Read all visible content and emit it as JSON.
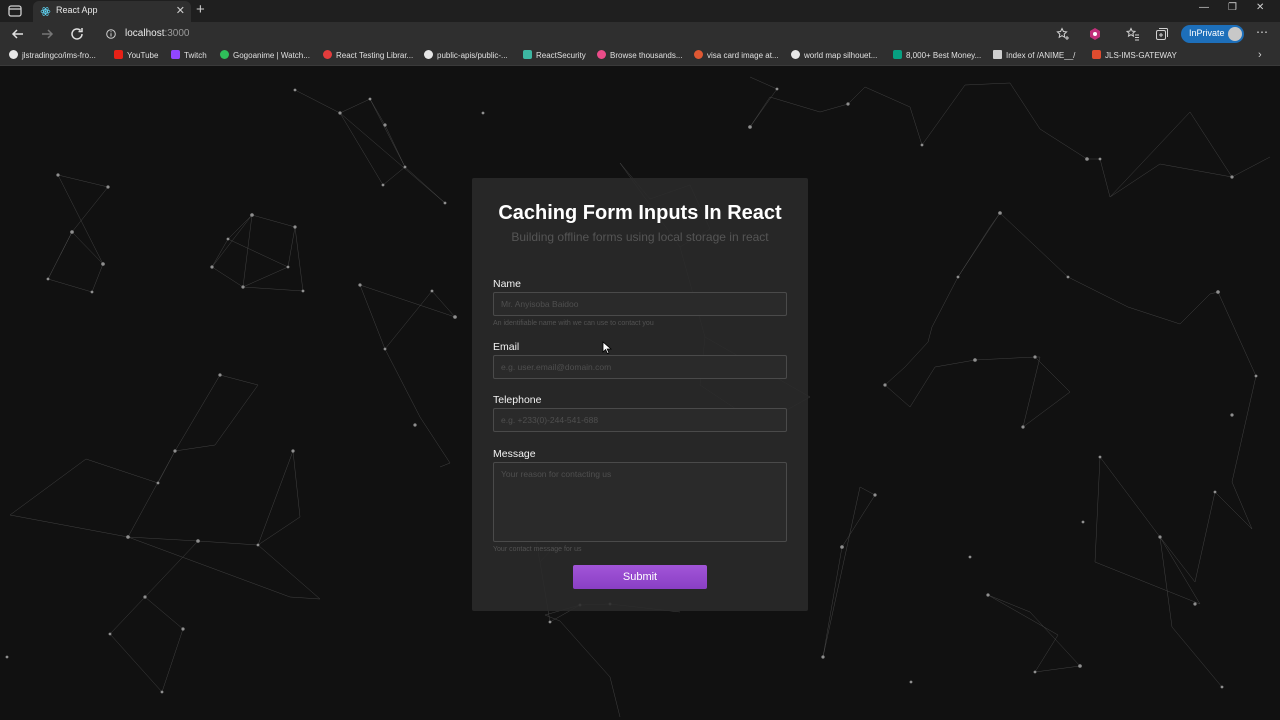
{
  "browser": {
    "tab_title": "React App",
    "url_host": "localhost",
    "url_port": ":3000",
    "inprivate_label": "InPrivate",
    "accent_color": "#1d6fba"
  },
  "bookmarks": [
    {
      "label": "jlstradingco/ims-fro...",
      "icon": "github-icon",
      "color": "#e6e6e6"
    },
    {
      "label": "YouTube",
      "icon": "youtube-icon",
      "color": "#e62117"
    },
    {
      "label": "Twitch",
      "icon": "twitch-icon",
      "color": "#9146ff"
    },
    {
      "label": "Gogoanime | Watch...",
      "icon": "gogoanime-icon",
      "color": "#2fbf5a"
    },
    {
      "label": "React Testing Librar...",
      "icon": "octopus-icon",
      "color": "#e33c3c"
    },
    {
      "label": "public-apis/public-...",
      "icon": "github-icon",
      "color": "#e6e6e6"
    },
    {
      "label": "ReactSecurity",
      "icon": "shield-icon",
      "color": "#3db7a2"
    },
    {
      "label": "Browse thousands...",
      "icon": "dribbble-icon",
      "color": "#ea4c89"
    },
    {
      "label": "visa card image at...",
      "icon": "duckduckgo-icon",
      "color": "#de5833"
    },
    {
      "label": "world map silhouet...",
      "icon": "google-icon",
      "color": "#e6e6e6"
    },
    {
      "label": "8,000+ Best Money...",
      "icon": "pexels-icon",
      "color": "#07a081"
    },
    {
      "label": "Index of /ANIME__/",
      "icon": "page-icon",
      "color": "#cfcfcf"
    },
    {
      "label": "JLS-IMS-GATEWAY",
      "icon": "gateway-icon",
      "color": "#e04c2f"
    }
  ],
  "form": {
    "title": "Caching Form Inputs In React",
    "subtitle": "Building offline forms using local storage in react",
    "name_label": "Name",
    "name_placeholder": "Mr. Anyisoba Baidoo",
    "name_help": "An identifiable name with we can use to contact you",
    "email_label": "Email",
    "email_placeholder": "e.g. user.email@domain.com",
    "phone_label": "Telephone",
    "phone_placeholder": "e.g. +233(0)-244-541-688",
    "message_label": "Message",
    "message_placeholder": "Your reason for contacting us",
    "message_help": "Your contact message for us",
    "submit_label": "Submit",
    "submit_color": "#9a4bd4"
  }
}
